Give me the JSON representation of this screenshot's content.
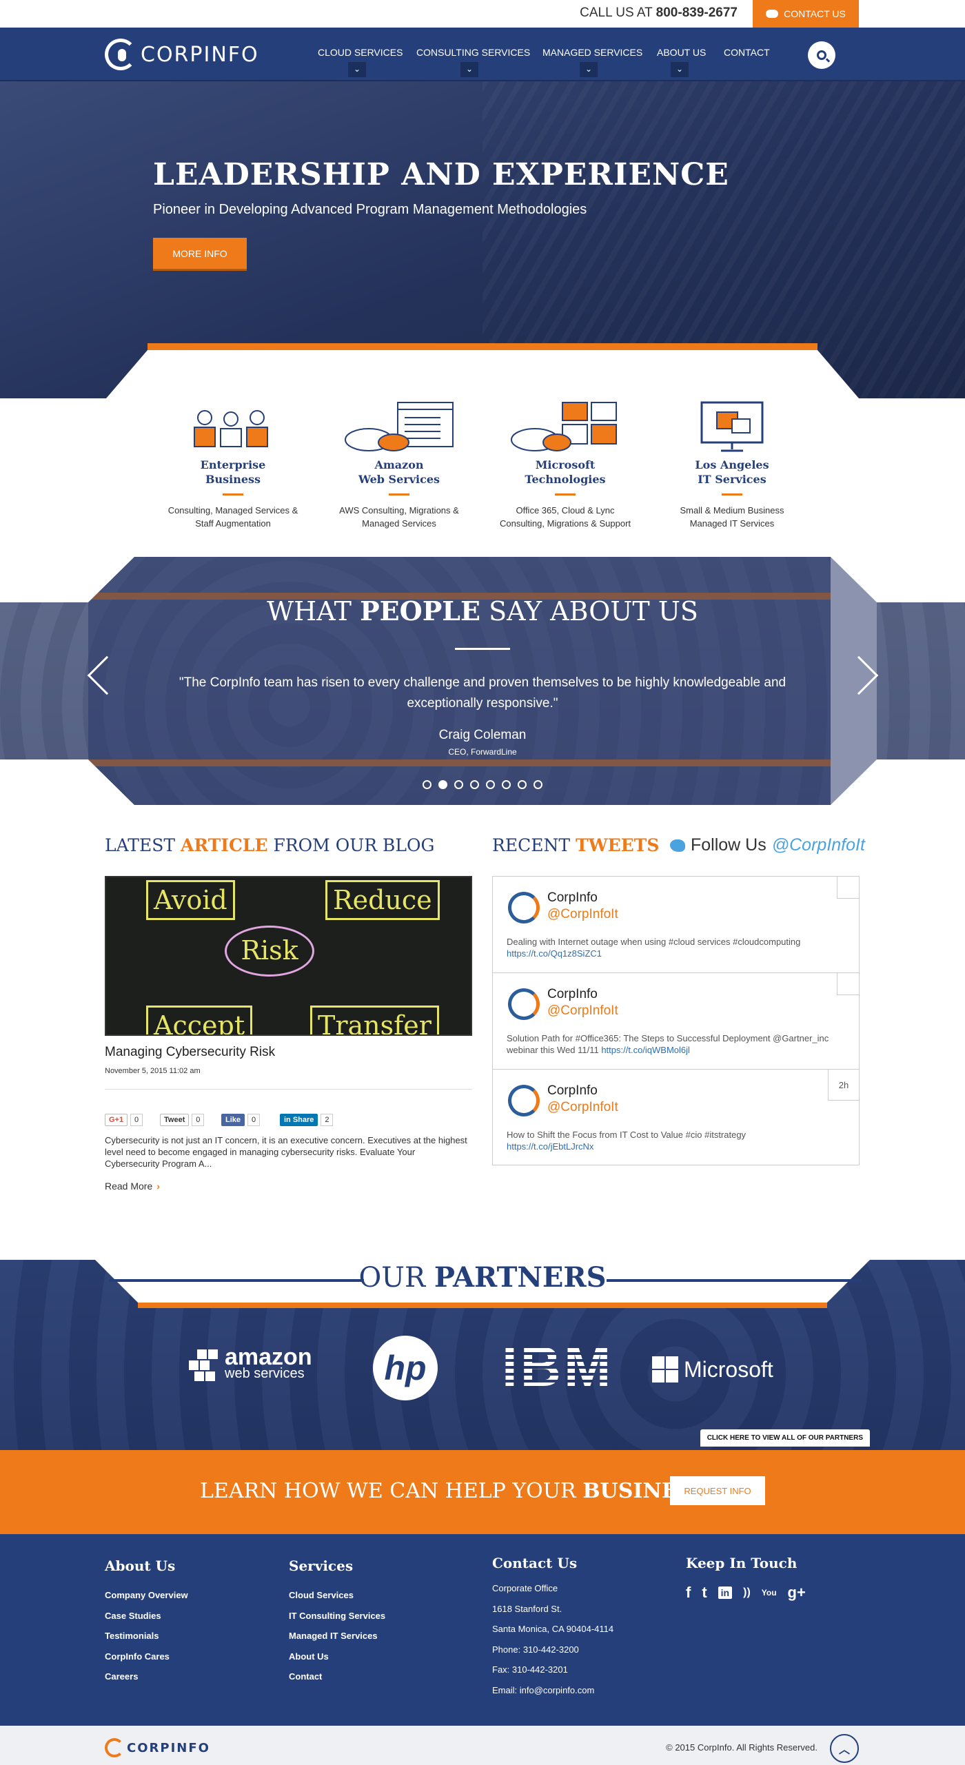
{
  "topbar": {
    "call_prefix": "CALL US AT",
    "phone": "800-839-2677",
    "contact_label": "CONTACT US"
  },
  "nav": {
    "logo_text": "CORPINFO",
    "items": [
      {
        "label": "CLOUD SERVICES",
        "has_dropdown": true
      },
      {
        "label": "CONSULTING SERVICES",
        "has_dropdown": true
      },
      {
        "label": "MANAGED SERVICES",
        "has_dropdown": true
      },
      {
        "label": "ABOUT US",
        "has_dropdown": true
      },
      {
        "label": "CONTACT",
        "has_dropdown": false
      }
    ],
    "search_icon": "search-icon",
    "caret_glyph": "⌄"
  },
  "hero": {
    "title": "LEADERSHIP AND EXPERIENCE",
    "subtitle": "Pioneer in Developing Advanced Program Management Methodologies",
    "button": "MORE INFO"
  },
  "services": [
    {
      "title_line1": "Enterprise",
      "title_line2": "Business",
      "desc_line1": "Consulting, Managed Services &",
      "desc_line2": "Staff Augmentation",
      "icon": "team-icon"
    },
    {
      "title_line1": "Amazon",
      "title_line2": "Web Services",
      "desc_line1": "AWS Consulting, Migrations &",
      "desc_line2": "Managed Services",
      "icon": "cloud-server-icon"
    },
    {
      "title_line1": "Microsoft",
      "title_line2": "Technologies",
      "desc_line1": "Office 365, Cloud & Lync",
      "desc_line2": "Consulting, Migrations & Support",
      "icon": "cloud-windows-icon"
    },
    {
      "title_line1": "Los Angeles",
      "title_line2": "IT Services",
      "desc_line1": "Small & Medium Business",
      "desc_line2": "Managed IT Services",
      "icon": "monitor-icon"
    }
  ],
  "testimonials": {
    "title_pre": "WHAT",
    "title_bold": "PEOPLE",
    "title_post": "SAY ABOUT US",
    "quote": "\"The CorpInfo team has risen to every challenge and proven themselves to be highly knowledgeable and exceptionally responsive.\"",
    "name": "Craig Coleman",
    "role": "CEO, ForwardLine",
    "slide_count": 8,
    "active_slide": 2
  },
  "blog": {
    "title_pre": "LATEST",
    "title_accent": "ARTICLE",
    "title_post": "FROM OUR BLOG",
    "image_words": {
      "avoid": "Avoid",
      "reduce": "Reduce",
      "risk": "Risk",
      "accept": "Accept",
      "transfer": "Transfer"
    },
    "post_title": "Managing Cybersecurity Risk",
    "date": "November 5, 2015 11:02 am",
    "share": {
      "gplus": {
        "label": "G+1",
        "count": "0"
      },
      "tweet": {
        "label": "Tweet",
        "count": "0"
      },
      "like": {
        "label": "Like",
        "count": "0"
      },
      "linkedin": {
        "label": "in Share",
        "count": "2"
      }
    },
    "excerpt": "Cybersecurity is not just an IT concern, it is an executive concern. Executives at the highest level need to become engaged in managing cybersecurity risks. Evaluate Your Cybersecurity Program A...",
    "read_more": "Read More",
    "read_more_arrow": "›"
  },
  "tweets": {
    "title_pre": "RECENT",
    "title_accent": "TWEETS",
    "follow_label": "Follow Us",
    "follow_handle": "@CorpInfoIt",
    "items": [
      {
        "name": "CorpInfo",
        "handle": "@CorpInfoIt",
        "text": "Dealing with Internet outage when using #cloud services #cloudcomputing",
        "link": "https://t.co/Qq1z8SiZC1",
        "time": ""
      },
      {
        "name": "CorpInfo",
        "handle": "@CorpInfoIt",
        "text": "Solution Path for #Office365: The Steps to Successful Deployment @Gartner_inc webinar this Wed 11/11",
        "link": "https://t.co/iqWBMol6jl",
        "time": ""
      },
      {
        "name": "CorpInfo",
        "handle": "@CorpInfoIt",
        "text": "How to Shift the Focus from IT Cost to Value #cio #itstrategy",
        "link": "https://t.co/jEbtLJrcNx",
        "time": "2h"
      }
    ]
  },
  "partners": {
    "title_pre": "OUR",
    "title_bold": "PARTNERS",
    "logos": {
      "amazon": {
        "line1": "amazon",
        "line2": "web services"
      },
      "hp": "hp",
      "ibm": "IBM",
      "microsoft": "Microsoft"
    },
    "view_all": "CLICK HERE TO VIEW ALL OF OUR PARTNERS"
  },
  "cta": {
    "text_pre": "LEARN HOW WE CAN HELP YOUR",
    "text_bold": "BUSINESS",
    "button": "REQUEST INFO"
  },
  "footer": {
    "about": {
      "title": "About Us",
      "links": [
        "Company Overview",
        "Case Studies",
        "Testimonials",
        "CorpInfo Cares",
        "Careers"
      ]
    },
    "services": {
      "title": "Services",
      "links": [
        "Cloud Services",
        "IT Consulting Services",
        "Managed IT Services",
        "About Us",
        "Contact"
      ]
    },
    "contact": {
      "title": "Contact Us",
      "lines": [
        "Corporate Office",
        "1618 Stanford St.",
        "Santa Monica, CA 90404-4114",
        "Phone: 310-442-3200",
        "Fax: 310-442-3201",
        "Email: info@corpinfo.com"
      ]
    },
    "social": {
      "title": "Keep In Touch",
      "glyphs": {
        "facebook": "f",
        "twitter": "t",
        "linkedin": "in",
        "rss": "))",
        "youtube": "You",
        "gplus": "g+"
      }
    }
  },
  "bottom": {
    "logo_text": "CORPINFO",
    "copyright": "© 2015 CorpInfo. All Rights Reserved.",
    "to_top_glyph": "︿"
  },
  "colors": {
    "navy": "#253f7a",
    "orange": "#ee7a1a",
    "twitter_blue": "#4aa3df"
  }
}
